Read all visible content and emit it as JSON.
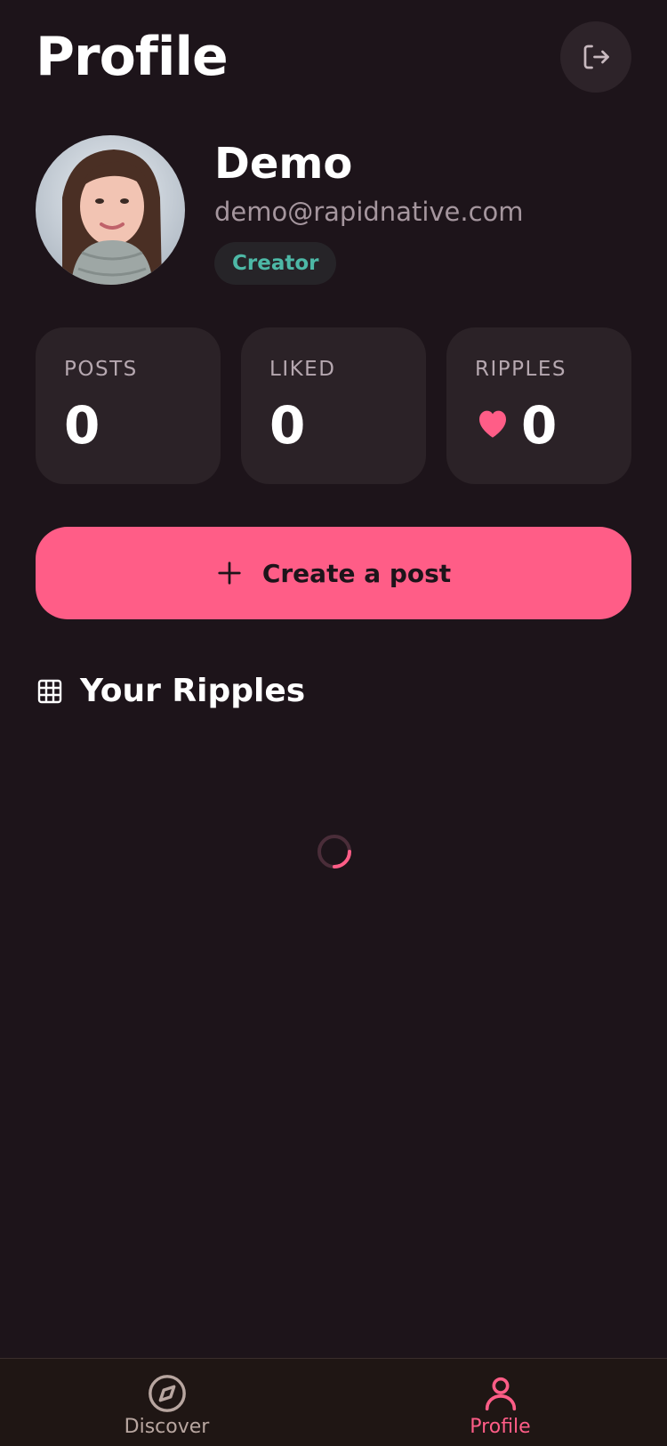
{
  "header": {
    "title": "Profile",
    "logout_icon": "logout-icon"
  },
  "profile": {
    "name": "Demo",
    "email": "demo@rapidnative.com",
    "role": "Creator",
    "avatar_icon": "user-avatar"
  },
  "stats": [
    {
      "label": "POSTS",
      "value": "0"
    },
    {
      "label": "LIKED",
      "value": "0"
    },
    {
      "label": "RIPPLES",
      "value": "0",
      "icon": "heart-icon"
    }
  ],
  "actions": {
    "create_label": "Create a post",
    "create_icon": "plus-icon"
  },
  "section": {
    "title": "Your Ripples",
    "icon": "grid-icon"
  },
  "tabbar": {
    "items": [
      {
        "label": "Discover",
        "icon": "compass-icon",
        "active": false
      },
      {
        "label": "Profile",
        "icon": "person-icon",
        "active": true
      }
    ]
  },
  "colors": {
    "background": "#1d141a",
    "card": "#2b2227",
    "accent": "#ff5d87",
    "badge_text": "#4db8a6",
    "muted_text": "#a5969e",
    "tab_inactive": "#b8a6a0"
  }
}
